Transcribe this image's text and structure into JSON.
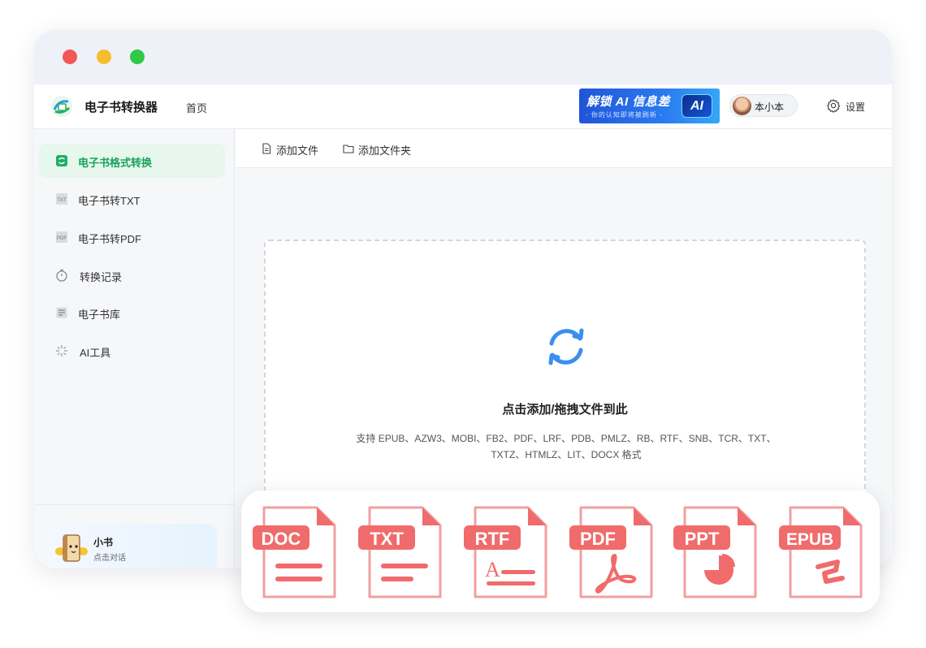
{
  "header": {
    "app_title": "电子书转换器",
    "home": "首页",
    "banner_main": "解锁 AI 信息差",
    "banner_sub": "- 你的认知即将被刷新 -",
    "banner_badge": "AI",
    "user_name": "本小本",
    "settings": "设置"
  },
  "sidebar": {
    "items": [
      {
        "label": "电子书格式转换",
        "icon": "ebook-convert-icon",
        "active": true
      },
      {
        "label": "电子书转TXT",
        "icon": "txt-file-icon",
        "active": false
      },
      {
        "label": "电子书转PDF",
        "icon": "pdf-file-icon",
        "active": false
      },
      {
        "label": "转换记录",
        "icon": "timer-icon",
        "active": false
      },
      {
        "label": "电子书库",
        "icon": "library-icon",
        "active": false
      },
      {
        "label": "AI工具",
        "icon": "sparkle-icon",
        "active": false
      }
    ],
    "assistant": {
      "name": "小书",
      "subtitle": "点击对话"
    }
  },
  "toolbar": {
    "add_file": "添加文件",
    "add_folder": "添加文件夹"
  },
  "dropzone": {
    "title": "点击添加/拖拽文件到此",
    "supported": "支持 EPUB、AZW3、MOBI、FB2、PDF、LRF、PDB、PMLZ、RB、RTF、SNB、TCR、TXT、TXTZ、HTMLZ、LIT、DOCX 格式"
  },
  "formats": [
    "DOC",
    "TXT",
    "RTF",
    "PDF",
    "PPT",
    "EPUB"
  ],
  "colors": {
    "accent_green": "#17a35c",
    "format_red": "#f06b6b",
    "sync_blue": "#3a8ef0"
  }
}
